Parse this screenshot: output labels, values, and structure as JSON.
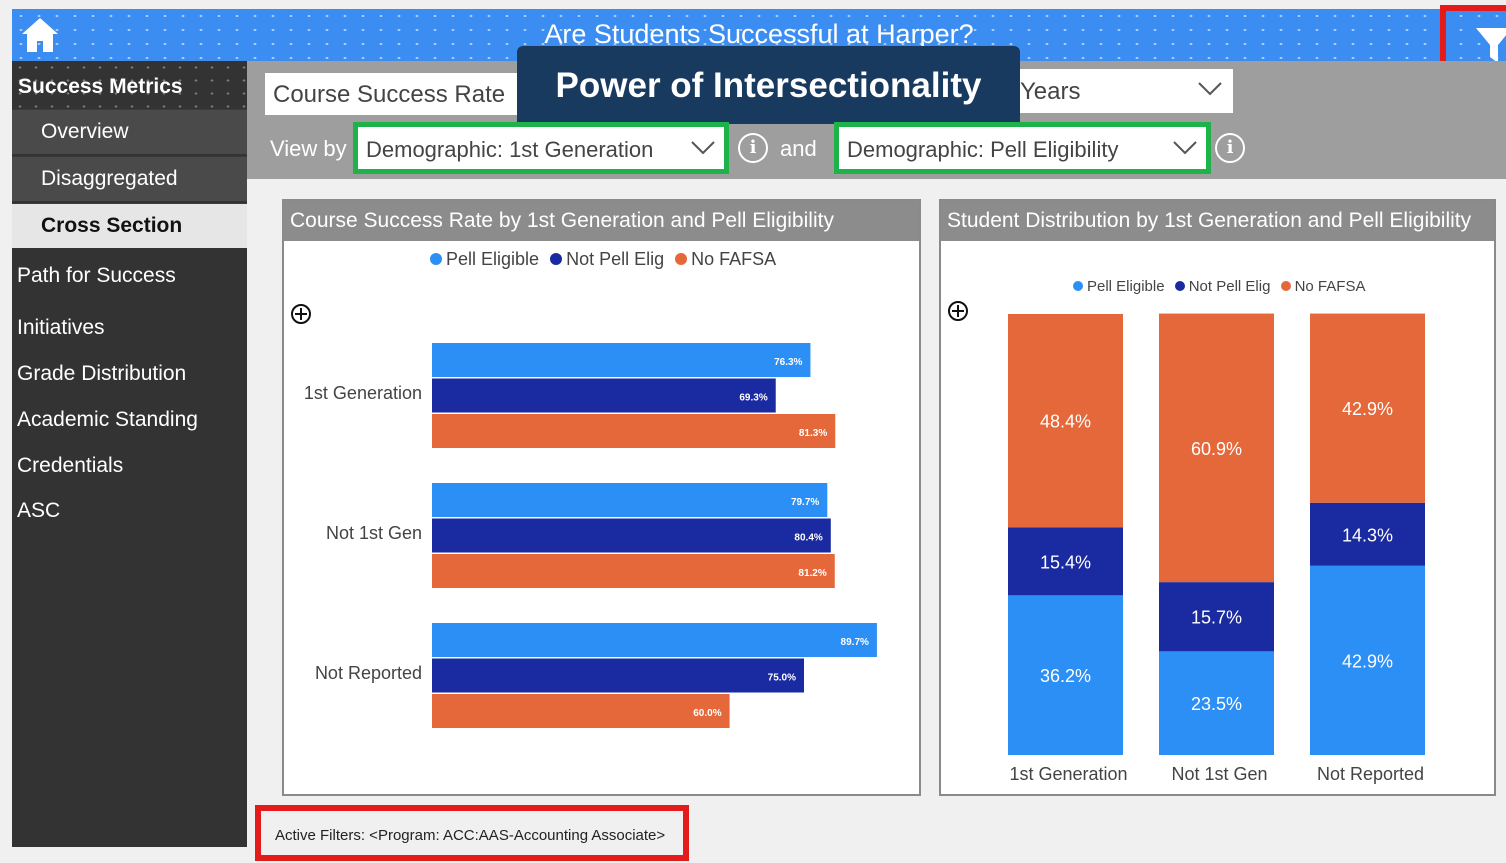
{
  "header": {
    "title": "Are Students Successful at Harper?"
  },
  "banner": {
    "text": "Power of Intersectionality"
  },
  "sidebar": {
    "heading": "Success Metrics",
    "sub_items": [
      {
        "label": "Overview",
        "active": false
      },
      {
        "label": "Disaggregated",
        "active": false
      },
      {
        "label": "Cross Section",
        "active": true
      }
    ],
    "items": [
      {
        "label": "Path for Success"
      },
      {
        "label": "Initiatives"
      },
      {
        "label": "Grade Distribution"
      },
      {
        "label": "Academic Standing"
      },
      {
        "label": "Credentials"
      },
      {
        "label": "ASC"
      }
    ]
  },
  "filters": {
    "metric_value": "Course Success Rate",
    "years_value": "Years",
    "view_by_label": "View by",
    "and_label": "and",
    "view_by_value": "Demographic: 1st Generation",
    "second_value": "Demographic: Pell Eligibility",
    "info_glyph": "i"
  },
  "colors": {
    "pell_eligible": "#2b8ff5",
    "not_pell_elig": "#1a2aa0",
    "no_fafsa": "#e5683a",
    "highlight_red": "#e31b1b",
    "highlight_green": "#1db34a"
  },
  "chart_data": [
    {
      "type": "bar",
      "orientation": "horizontal",
      "title": "Course Success Rate by 1st Generation and Pell Eligibility",
      "categories": [
        "1st Generation",
        "Not 1st Gen",
        "Not Reported"
      ],
      "series": [
        {
          "name": "Pell Eligible",
          "values": [
            76.3,
            79.7,
            89.7
          ]
        },
        {
          "name": "Not Pell Elig",
          "values": [
            69.3,
            80.4,
            75.0
          ]
        },
        {
          "name": "No FAFSA",
          "values": [
            81.3,
            81.2,
            60.0
          ]
        }
      ],
      "value_labels": [
        [
          "76.3%",
          "79.7%",
          "89.7%"
        ],
        [
          "69.3%",
          "80.4%",
          "75.0%"
        ],
        [
          "81.3%",
          "81.2%",
          "60.0%"
        ]
      ],
      "xlim": [
        0,
        100
      ],
      "legend": "top",
      "grid": false
    },
    {
      "type": "bar",
      "stacked": true,
      "title": "Student Distribution by 1st Generation and Pell Eligibility",
      "categories": [
        "1st Generation",
        "Not 1st Gen",
        "Not Reported"
      ],
      "series": [
        {
          "name": "Pell Eligible",
          "values": [
            36.2,
            23.5,
            42.9
          ]
        },
        {
          "name": "Not Pell Elig",
          "values": [
            15.4,
            15.7,
            14.3
          ]
        },
        {
          "name": "No FAFSA",
          "values": [
            48.4,
            60.9,
            42.9
          ]
        }
      ],
      "value_labels": [
        [
          "36.2%",
          "23.5%",
          "42.9%"
        ],
        [
          "15.4%",
          "15.7%",
          "14.3%"
        ],
        [
          "48.4%",
          "60.9%",
          "42.9%"
        ]
      ],
      "ylim": [
        0,
        100
      ],
      "legend": "top",
      "grid": false
    }
  ],
  "active_filters": {
    "text": "Active Filters:  <Program: ACC:AAS-Accounting Associate>"
  }
}
